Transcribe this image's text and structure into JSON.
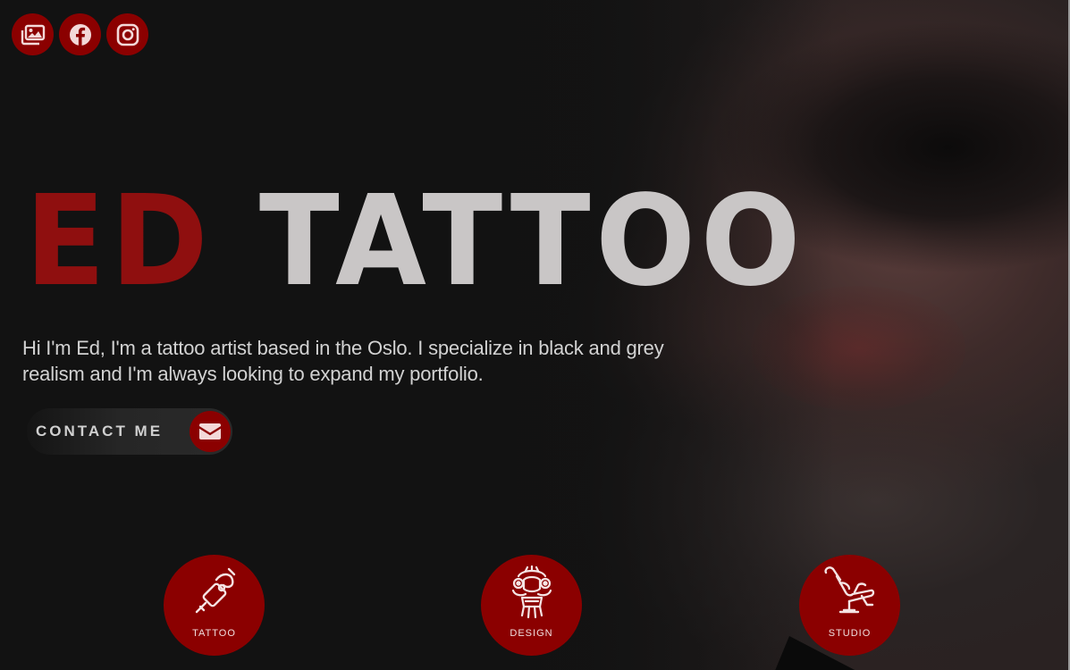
{
  "social": {
    "items": [
      {
        "name": "gallery",
        "icon": "images-icon"
      },
      {
        "name": "facebook",
        "icon": "facebook-icon"
      },
      {
        "name": "instagram",
        "icon": "instagram-icon"
      }
    ]
  },
  "hero": {
    "title_red": "ED",
    "title_grey": "TATTOO",
    "description": "Hi I'm Ed, I'm a tattoo artist based in the Oslo. I specialize in black and grey realism and I'm always looking to expand my portfolio."
  },
  "contact": {
    "label": "CONTACT ME",
    "icon": "envelope-icon"
  },
  "services": [
    {
      "label": "TATTOO",
      "icon": "tattoo-machine-icon"
    },
    {
      "label": "DESIGN",
      "icon": "dragon-mask-icon"
    },
    {
      "label": "STUDIO",
      "icon": "tattoo-chair-icon"
    }
  ],
  "colors": {
    "accent": "#8b0000",
    "title_red": "#8f0f0f",
    "title_grey": "#c9c6c6",
    "text": "#d2d2d2",
    "background": "#151515"
  }
}
